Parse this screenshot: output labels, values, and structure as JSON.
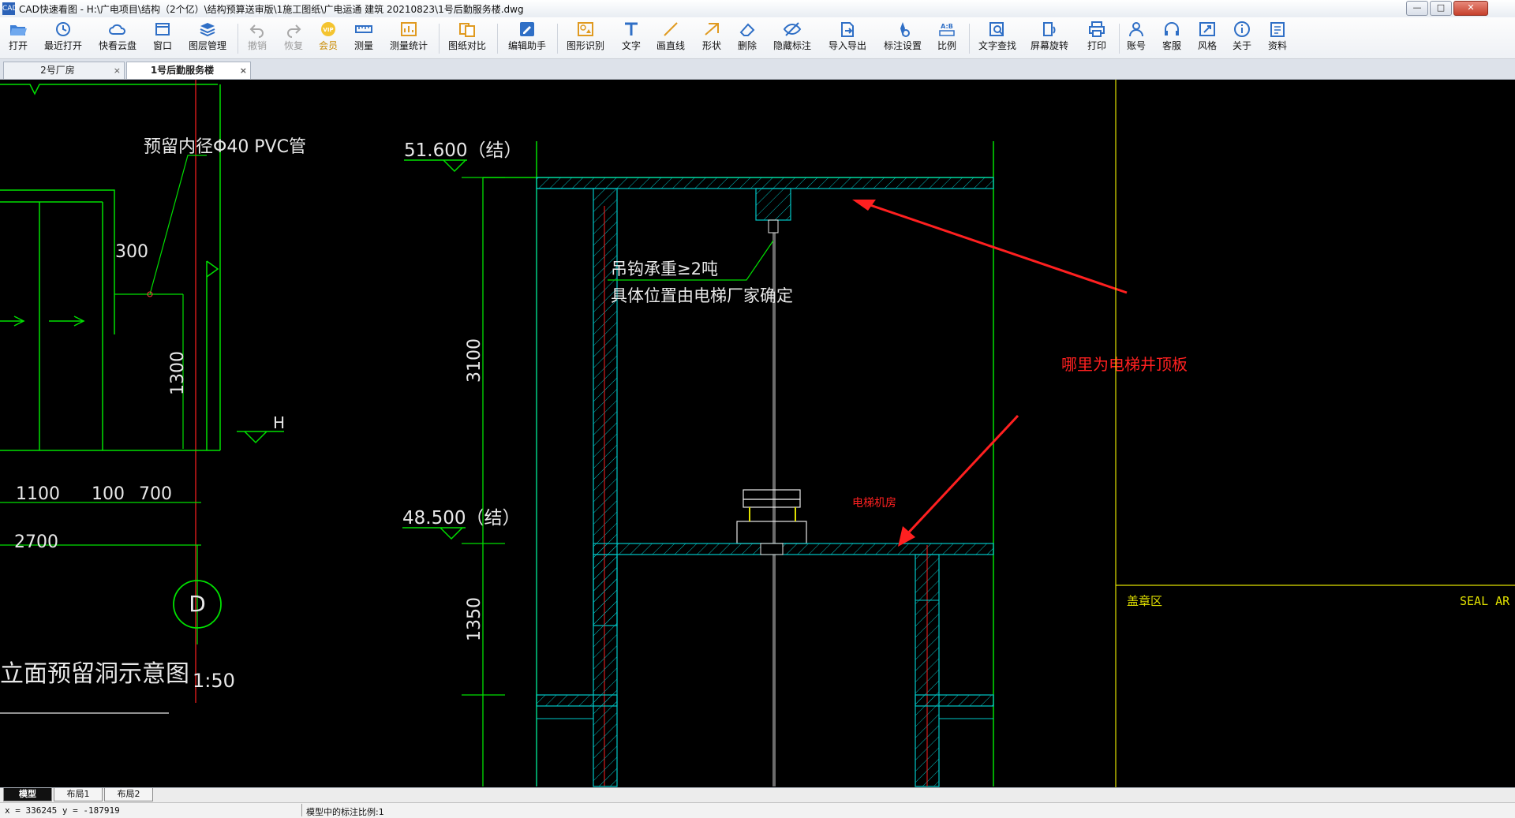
{
  "window": {
    "app_icon_text": "CAD",
    "title": "CAD快速看图 - H:\\广电项目\\结构（2个亿）\\结构预算送审版\\1施工图纸\\广电运通 建筑 20210823\\1号后勤服务楼.dwg",
    "controls": {
      "minimize": "—",
      "maximize": "□",
      "close": "✕"
    }
  },
  "toolbar": {
    "items": [
      {
        "label": "打开",
        "icon": "folder-open-icon"
      },
      {
        "label": "最近打开",
        "icon": "history-icon"
      },
      {
        "label": "快看云盘",
        "icon": "cloud-icon"
      },
      {
        "label": "窗口",
        "icon": "window-icon"
      },
      {
        "label": "图层管理",
        "icon": "layers-icon"
      },
      {
        "label": "撤销",
        "icon": "undo-icon"
      },
      {
        "label": "恢复",
        "icon": "redo-icon"
      },
      {
        "label": "会员",
        "icon": "vip-icon"
      },
      {
        "label": "测量",
        "icon": "ruler-icon"
      },
      {
        "label": "测量统计",
        "icon": "measure-stats-icon"
      },
      {
        "label": "图纸对比",
        "icon": "compare-icon"
      },
      {
        "label": "编辑助手",
        "icon": "edit-assistant-icon"
      },
      {
        "label": "图形识别",
        "icon": "shape-recognition-icon"
      },
      {
        "label": "文字",
        "icon": "text-icon"
      },
      {
        "label": "画直线",
        "icon": "line-icon"
      },
      {
        "label": "形状",
        "icon": "shape-icon"
      },
      {
        "label": "删除",
        "icon": "eraser-icon"
      },
      {
        "label": "隐藏标注",
        "icon": "hide-annotation-icon"
      },
      {
        "label": "导入导出",
        "icon": "import-export-icon"
      },
      {
        "label": "标注设置",
        "icon": "annotation-settings-icon"
      },
      {
        "label": "比例",
        "icon": "scale-icon"
      },
      {
        "label": "文字查找",
        "icon": "text-search-icon"
      },
      {
        "label": "屏幕旋转",
        "icon": "rotate-screen-icon"
      },
      {
        "label": "打印",
        "icon": "printer-icon"
      },
      {
        "label": "账号",
        "icon": "account-icon"
      },
      {
        "label": "客服",
        "icon": "headset-icon"
      },
      {
        "label": "风格",
        "icon": "style-icon"
      },
      {
        "label": "关于",
        "icon": "info-icon"
      },
      {
        "label": "资料",
        "icon": "documents-icon"
      }
    ]
  },
  "doc_tabs": [
    {
      "label": "2号厂房",
      "close": "×",
      "active": false
    },
    {
      "label": "1号后勤服务楼",
      "close": "×",
      "active": true
    }
  ],
  "drawing": {
    "left_note": "预留内径Φ40 PVC管",
    "dim_300": "300",
    "dim_1300": "1300",
    "axis_h": "H",
    "dim_1100": "1100",
    "dim_100": "100",
    "dim_700": "700",
    "dim_2700": "2700",
    "axis_d": "D",
    "left_title": "立面预留洞示意图",
    "left_scale": "1:50",
    "elev_top": "51.600（结）",
    "elev_mid": "48.500（结）",
    "dim_3100": "3100",
    "dim_1350": "1350",
    "hook_note_1": "吊钩承重≥2吨",
    "hook_note_2": "具体位置由电梯厂家确定",
    "machine_room": "电梯机房",
    "question": "哪里为电梯井顶板",
    "seal_label": "盖章区",
    "seal_en": "SEAL AR",
    "colors": {
      "line_green": "#00e000",
      "hatch_cyan": "#00c8c8",
      "text_white": "#e8e8e8",
      "red": "#ff2020",
      "yellow": "#e0e000"
    }
  },
  "layout_tabs": [
    {
      "label": "模型",
      "active": true
    },
    {
      "label": "布局1",
      "active": false
    },
    {
      "label": "布局2",
      "active": false
    }
  ],
  "status": {
    "coords": "x = 336245  y = -187919",
    "scale_text": "模型中的标注比例:1"
  }
}
